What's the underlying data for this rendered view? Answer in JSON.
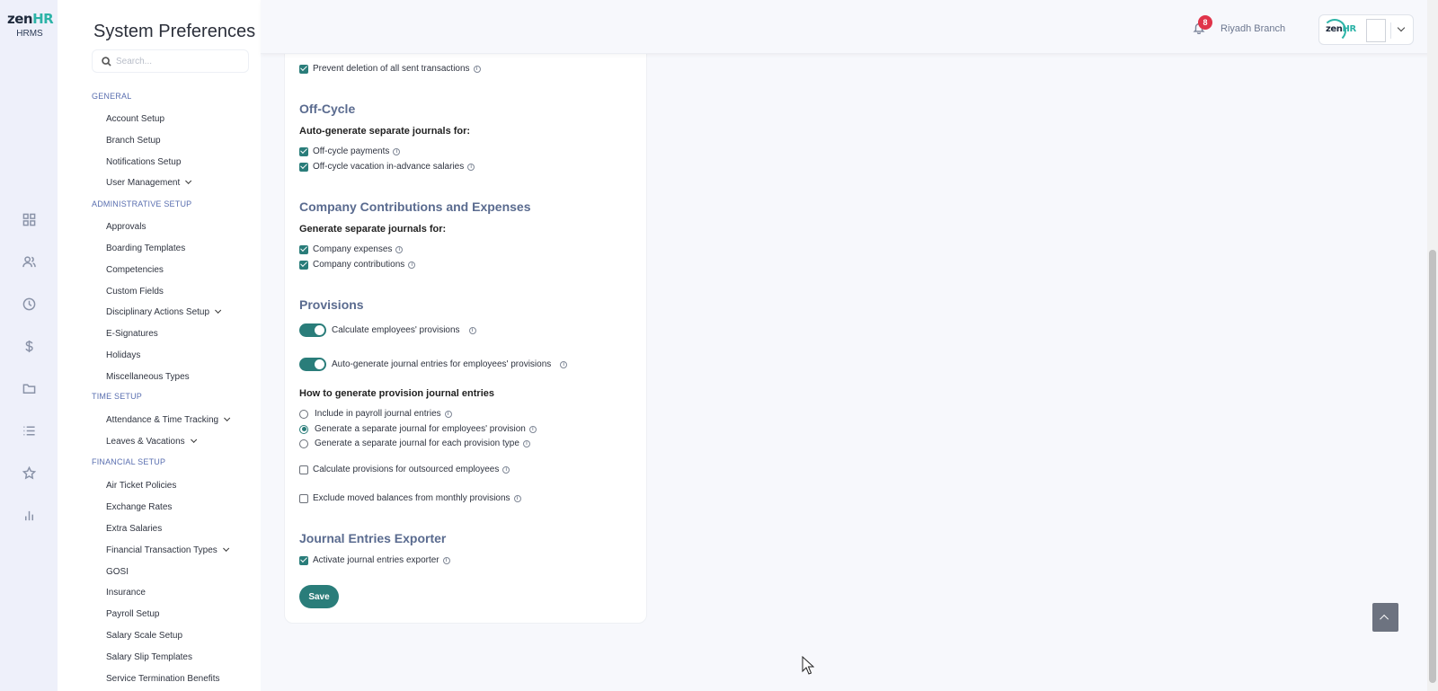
{
  "app": {
    "brand_main": "zen",
    "brand_accent": "HR",
    "brand_sub": "HRMS"
  },
  "rail_icons": [
    "dashboard-icon",
    "people-icon",
    "clock-icon",
    "dollar-icon",
    "folder-icon",
    "list-icon",
    "star-icon",
    "bar-chart-icon"
  ],
  "nav": {
    "title": "System Preferences",
    "search_placeholder": "Search...",
    "sections": {
      "general": "GENERAL",
      "administrative": "ADMINISTRATIVE SETUP",
      "time": "TIME SETUP",
      "financial": "FINANCIAL SETUP"
    },
    "items": {
      "account_setup": "Account Setup",
      "branch_setup": "Branch Setup",
      "notifications_setup": "Notifications Setup",
      "user_management": "User Management",
      "approvals": "Approvals",
      "boarding_templates": "Boarding Templates",
      "competencies": "Competencies",
      "custom_fields": "Custom Fields",
      "disciplinary_actions": "Disciplinary Actions Setup",
      "e_signatures": "E-Signatures",
      "holidays": "Holidays",
      "misc_types": "Miscellaneous Types",
      "attendance": "Attendance & Time Tracking",
      "leaves": "Leaves & Vacations",
      "air_ticket": "Air Ticket Policies",
      "exchange_rates": "Exchange Rates",
      "extra_salaries": "Extra Salaries",
      "financial_transaction_types": "Financial Transaction Types",
      "gosi": "GOSI",
      "insurance": "Insurance",
      "payroll_setup": "Payroll Setup",
      "salary_scale": "Salary Scale Setup",
      "salary_slip": "Salary Slip Templates",
      "service_termination": "Service Termination Benefits"
    }
  },
  "header": {
    "notification_count": "8",
    "branch": "Riyadh Branch",
    "profile_brand_main": "zen",
    "profile_brand_accent": "HR"
  },
  "form": {
    "prevent_deletion": "Prevent deletion of all sent transactions",
    "off_cycle": {
      "title": "Off-Cycle",
      "subtitle": "Auto-generate separate journals for:",
      "payments": "Off-cycle payments",
      "vacation": "Off-cycle vacation in-advance salaries"
    },
    "company": {
      "title": "Company Contributions and Expenses",
      "subtitle": "Generate separate journals for:",
      "expenses": "Company expenses",
      "contributions": "Company contributions"
    },
    "provisions": {
      "title": "Provisions",
      "calculate": "Calculate employees' provisions",
      "auto_generate": "Auto-generate journal entries for employees' provisions",
      "how_title": "How to generate provision journal entries",
      "radio_include": "Include in payroll journal entries",
      "radio_separate_employee": "Generate a separate journal for employees' provision",
      "radio_separate_type": "Generate a separate journal for each provision type",
      "outsourced": "Calculate provisions for outsourced employees",
      "exclude_moved": "Exclude moved balances from monthly provisions"
    },
    "exporter": {
      "title": "Journal Entries Exporter",
      "activate": "Activate journal entries exporter"
    },
    "save_label": "Save",
    "info_glyph": "i"
  },
  "colors": {
    "accent": "#2a7d7a",
    "brand_teal": "#2cb3a7",
    "badge": "#e0344a",
    "section_title": "#5a6b8f"
  }
}
